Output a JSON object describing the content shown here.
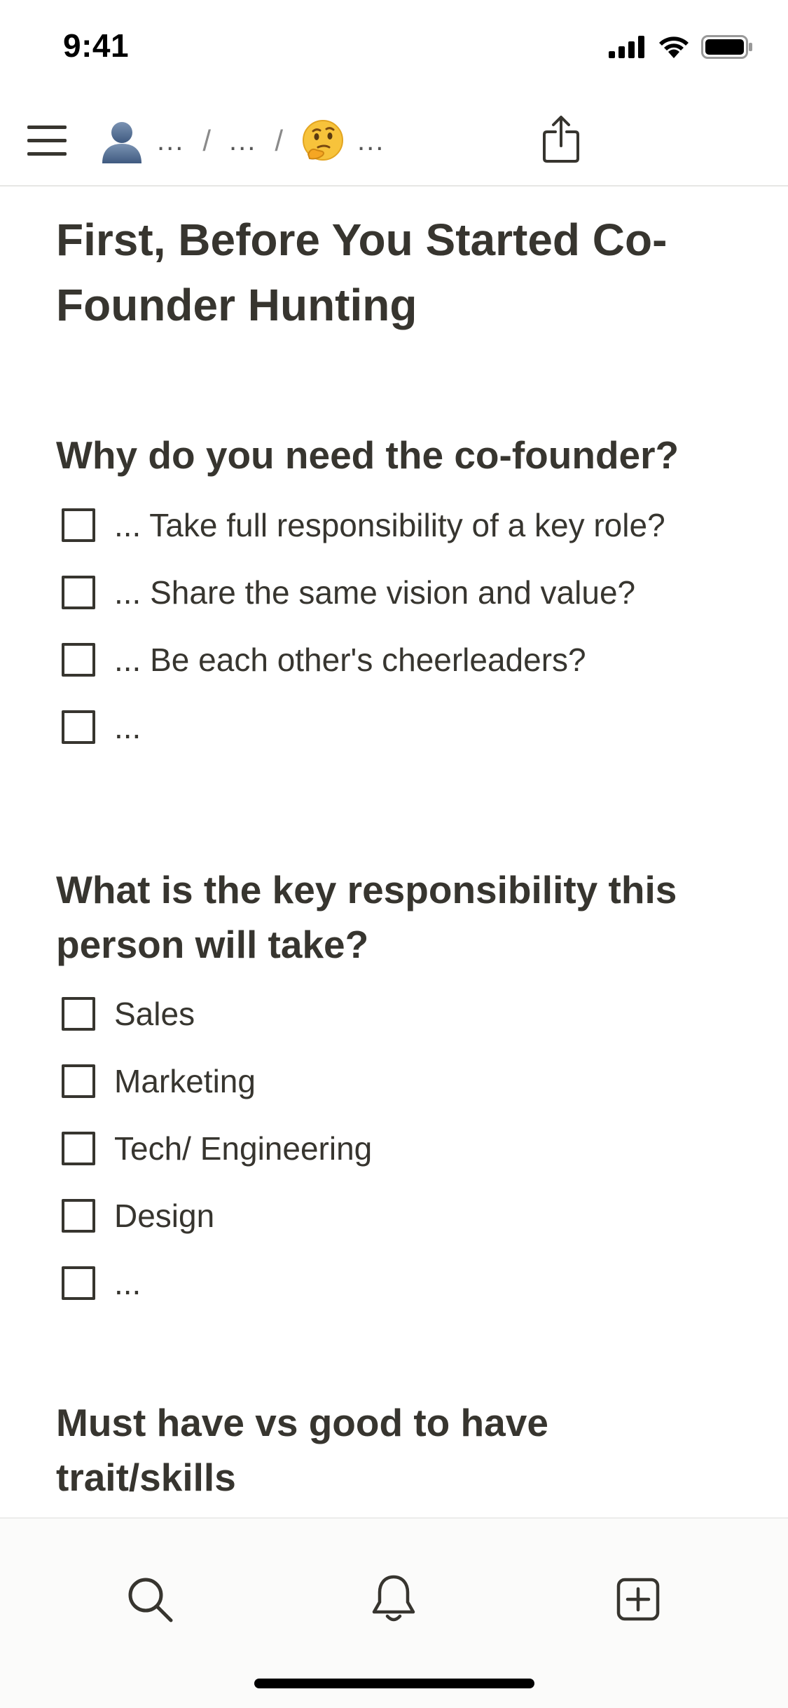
{
  "status": {
    "time": "9:41"
  },
  "nav": {
    "crumbs": [
      {
        "icon": "person-icon",
        "label": "..."
      },
      {
        "icon": "",
        "label": "..."
      },
      {
        "icon": "thinking-face-icon",
        "label": "..."
      }
    ],
    "separator": "/"
  },
  "page": {
    "title": "First, Before You Started Co-Founder Hunting",
    "sections": [
      {
        "heading": "Why do you need the co-founder?",
        "todos": [
          "... Take full responsibility of a key role?",
          "... Share the same vision and value?",
          "... Be each other's cheerleaders?",
          "..."
        ]
      },
      {
        "heading": "What is the key responsibility this person will take?",
        "todos": [
          "Sales",
          "Marketing",
          "Tech/ Engineering",
          "Design",
          "..."
        ]
      },
      {
        "heading": "Must have vs good to have trait/skills",
        "todos": []
      }
    ]
  },
  "bottombar": {
    "tabs": [
      "search-icon",
      "bell-icon",
      "new-page-icon"
    ]
  },
  "colors": {
    "text": "#37352f",
    "divider": "#e6e6e4",
    "bottombar_bg": "#fbfbfa"
  }
}
